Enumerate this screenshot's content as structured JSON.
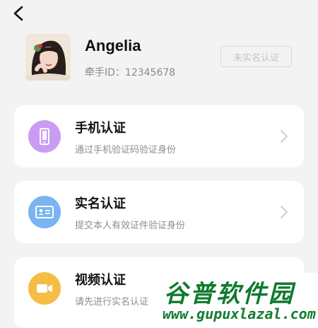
{
  "header": {
    "back_icon": "chevron-left-icon"
  },
  "profile": {
    "avatar_icon": "user-avatar",
    "name": "Angelia",
    "id_text": "牵手ID：12345678",
    "verify_badge": "未实名认证"
  },
  "cards": [
    {
      "title": "手机认证",
      "desc": "通过手机验证码验证身份",
      "icon": "phone-icon",
      "color": "#c99cf2"
    },
    {
      "title": "实名认证",
      "desc": "提交本人有效证件验证身份",
      "icon": "id-card-icon",
      "color": "#7ab4f2"
    },
    {
      "title": "视频认证",
      "desc": "请先进行实名认证",
      "icon": "video-camera-icon",
      "color": "#f5bd45"
    }
  ],
  "watermark": {
    "title": "谷普软件园",
    "url": "www.gupuxlazal.com"
  }
}
